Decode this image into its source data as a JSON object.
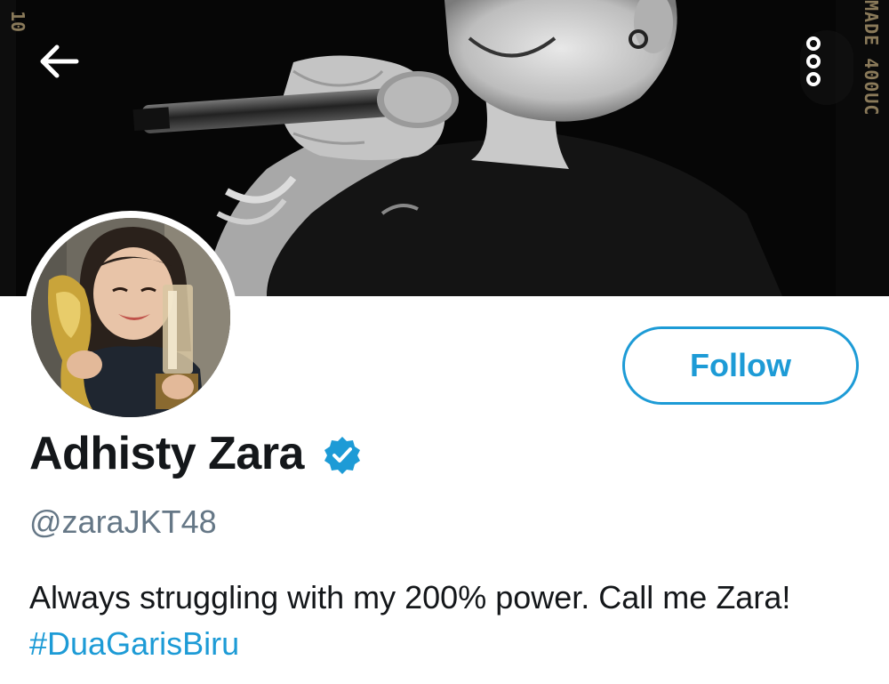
{
  "banner": {
    "film_left": "10",
    "film_right": "MADE 400UC"
  },
  "nav": {
    "back_icon": "arrow-left-icon",
    "more_icon": "more-vertical-icon"
  },
  "profile": {
    "follow_label": "Follow",
    "display_name": "Adhisty Zara",
    "verified_icon": "verified-badge-icon",
    "handle": "@zaraJKT48",
    "bio_text": "Always struggling with my 200% power. Call me Zara!",
    "bio_hashtag": "#DuaGarisBiru"
  },
  "colors": {
    "accent": "#1d9bd6",
    "text": "#14171a",
    "muted": "#657786"
  }
}
